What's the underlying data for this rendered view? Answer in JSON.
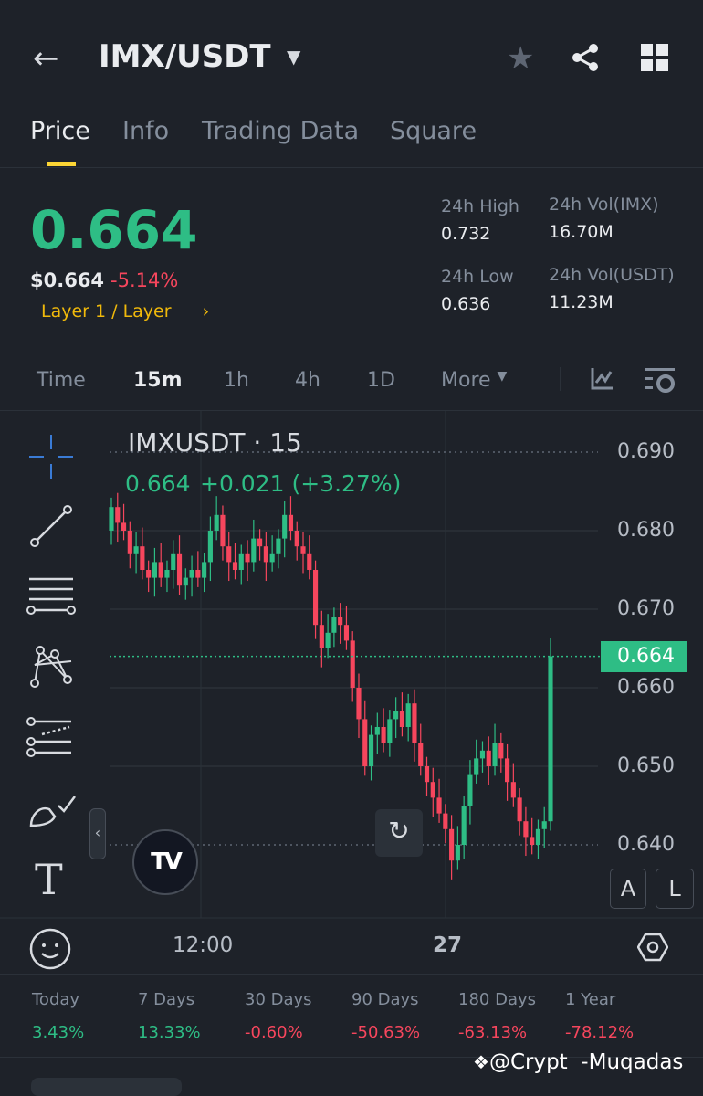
{
  "header": {
    "title": "IMX/USDT"
  },
  "tabs": [
    {
      "label": "Price"
    },
    {
      "label": "Info"
    },
    {
      "label": "Trading Data"
    },
    {
      "label": "Square"
    }
  ],
  "price": {
    "last": "0.664",
    "usd": "$0.664",
    "change": "-5.14%",
    "category": "Layer 1 / Layer",
    "chevron": "›"
  },
  "stats": {
    "high_label": "24h High",
    "high": "0.732",
    "low_label": "24h Low",
    "low": "0.636",
    "vol_imx_label": "24h Vol(IMX)",
    "vol_imx": "16.70M",
    "vol_usdt_label": "24h Vol(USDT)",
    "vol_usdt": "11.23M"
  },
  "timeframes": [
    {
      "label": "Time"
    },
    {
      "label": "15m"
    },
    {
      "label": "1h"
    },
    {
      "label": "4h"
    },
    {
      "label": "1D"
    },
    {
      "label": "More"
    }
  ],
  "chart": {
    "symbol": "IMXUSDT · 15",
    "legend_price": "0.664",
    "legend_change": "+0.021 (+3.27%)",
    "current_price": "0.664",
    "x_labels": [
      "12:00",
      "27"
    ],
    "btn_a": "A",
    "btn_l": "L",
    "logo": "TV"
  },
  "colors": {
    "up": "#2ebd85",
    "down": "#f6465d",
    "accent": "#fcd535",
    "bg": "#1e2229"
  },
  "chart_data": {
    "type": "candlestick",
    "title": "IMXUSDT · 15",
    "y_ticks": [
      0.69,
      0.68,
      0.67,
      0.66,
      0.65,
      0.64
    ],
    "ylim": [
      0.636,
      0.6915
    ],
    "first_open": 0.68,
    "close": [
      0.683,
      0.681,
      0.68,
      0.677,
      0.678,
      0.675,
      0.674,
      0.676,
      0.674,
      0.675,
      0.677,
      0.673,
      0.674,
      0.675,
      0.674,
      0.676,
      0.68,
      0.682,
      0.678,
      0.676,
      0.675,
      0.677,
      0.676,
      0.679,
      0.678,
      0.676,
      0.677,
      0.679,
      0.682,
      0.68,
      0.678,
      0.677,
      0.675,
      0.668,
      0.665,
      0.667,
      0.669,
      0.668,
      0.666,
      0.66,
      0.656,
      0.65,
      0.654,
      0.655,
      0.653,
      0.656,
      0.657,
      0.655,
      0.658,
      0.653,
      0.65,
      0.648,
      0.646,
      0.644,
      0.642,
      0.638,
      0.64,
      0.645,
      0.649,
      0.651,
      0.652,
      0.65,
      0.653,
      0.651,
      0.648,
      0.646,
      0.643,
      0.641,
      0.64,
      0.642,
      0.643,
      0.664
    ]
  },
  "performance": [
    {
      "label": "Today",
      "value": "3.43%"
    },
    {
      "label": "7 Days",
      "value": "13.33%"
    },
    {
      "label": "30 Days",
      "value": "-0.60%"
    },
    {
      "label": "90 Days",
      "value": "-50.63%"
    },
    {
      "label": "180 Days",
      "value": "-63.13%"
    },
    {
      "label": "1 Year",
      "value": "-78.12%"
    }
  ],
  "watermark": "@Crypt  -Muqadas"
}
